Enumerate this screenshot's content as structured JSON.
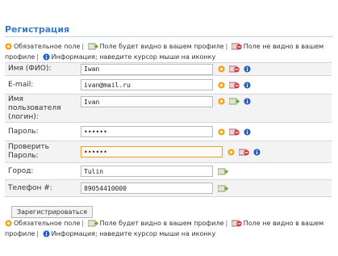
{
  "page": {
    "title": "Регистрация"
  },
  "legend": {
    "required": "Обязательное поле",
    "visible_profile": "Поле будет видно в вашем профиле",
    "not_visible": "Поле не видно в вашем профиле",
    "info": "Информация; наведите курсор мыши на иконку"
  },
  "fields": [
    {
      "label": "Имя (ФИО):",
      "value": "Iwan",
      "type": "text"
    },
    {
      "label": "E-mail:",
      "value": "ivan@mail.ru",
      "type": "text"
    },
    {
      "label": "Имя пользователя (логин):",
      "value": "Ivan",
      "type": "text"
    },
    {
      "label": "Пароль:",
      "value": "••••••",
      "type": "password"
    },
    {
      "label": "Проверить Пароль:",
      "value": "••••••",
      "type": "password"
    },
    {
      "label": "Город:",
      "value": "Tulin",
      "type": "text"
    },
    {
      "label": "Телефон #:",
      "value": "89054410000",
      "type": "text"
    }
  ],
  "submit": {
    "label": "Зарегистрироваться"
  },
  "colors": {
    "title": "#3a7cc3",
    "required_icon": "#f0a020",
    "hidden_icon": "#d33",
    "visible_icon": "#6aa832",
    "info_icon": "#1f5fc9"
  },
  "icons": [
    "required-icon",
    "profile-visible-icon",
    "profile-hidden-icon",
    "info-icon"
  ]
}
